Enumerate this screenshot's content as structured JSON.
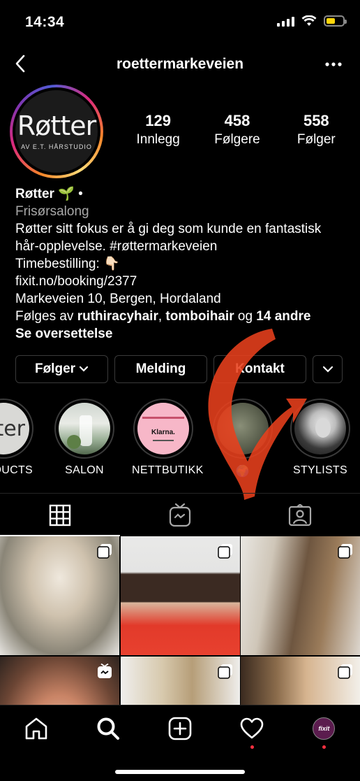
{
  "status_bar": {
    "time": "14:34",
    "battery_color": "#ffd60a"
  },
  "header": {
    "username": "roettermarkeveien",
    "back_icon": "chevron-left-icon",
    "more_icon": "more-horizontal-icon"
  },
  "profile": {
    "avatar": {
      "brand": "Røtter",
      "brand_sub": "AV E.T. HÅRSTUDIO"
    },
    "stats": [
      {
        "value": "129",
        "label": "Innlegg"
      },
      {
        "value": "458",
        "label": "Følgere"
      },
      {
        "value": "558",
        "label": "Følger"
      }
    ],
    "name": "Røtter",
    "name_suffix": " 🌱 •",
    "category": "Frisørsalong",
    "bio_line1": "Røtter sitt fokus er å gi deg som kunde en fantastisk",
    "bio_line2": "hår-opplevelse. #røttermarkeveien",
    "bio_line3": "Timebestilling: 👇🏻",
    "link": "fixit.no/booking/2377",
    "address": "Markeveien 10, Bergen, Hordaland",
    "followed_by_prefix": "Følges av ",
    "followed_by_1": "ruthiracyhair",
    "followed_by_sep": ", ",
    "followed_by_2": "tomboihair",
    "followed_by_and": " og ",
    "followed_by_rest": "14 andre",
    "translate": "Se oversettelse"
  },
  "actions": {
    "follow": "Følger",
    "message": "Melding",
    "contact": "Kontakt"
  },
  "highlights": [
    {
      "label": "DUCTS"
    },
    {
      "label": "SALON"
    },
    {
      "label": "NETTBUTIKK",
      "card_text": "Klarna."
    },
    {
      "label": "🌍"
    },
    {
      "label": "STYLISTS"
    }
  ],
  "tabs": [
    "grid-icon",
    "igtv-icon",
    "tagged-icon"
  ],
  "bottom_nav": [
    "home-icon",
    "search-icon",
    "create-icon",
    "heart-icon",
    "profile-avatar"
  ],
  "bottom_nav_avatar_text": "fixit",
  "accent_colors": {
    "notification_dot": "#ff3040",
    "annotation_arrow": "#e8401c"
  }
}
